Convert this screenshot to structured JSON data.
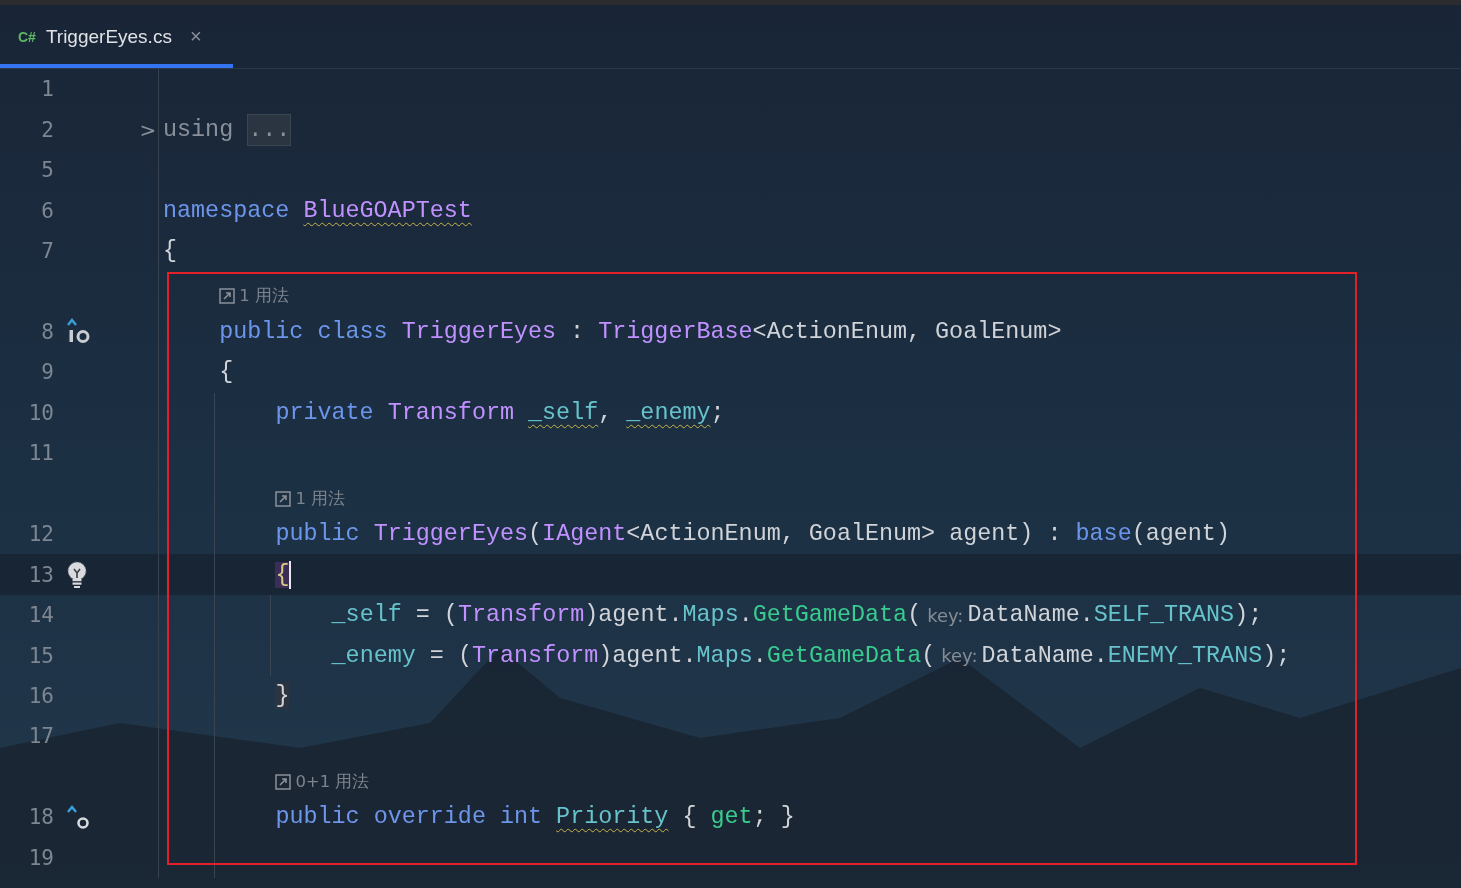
{
  "tab": {
    "lang": "C#",
    "title": "TriggerEyes.cs",
    "close": "×",
    "selected": true
  },
  "rows": [
    {
      "kind": "line",
      "number": "1",
      "current": false,
      "tokens": []
    },
    {
      "kind": "line",
      "number": "2",
      "current": false,
      "gutter": {
        "kind": "fold-collapsed",
        "text": ">"
      },
      "tokens": [
        {
          "text": "using ",
          "kind": "dim",
          "squiggly": false
        },
        {
          "text": "...",
          "kind": "folded",
          "squiggly": false
        }
      ]
    },
    {
      "kind": "line",
      "number": "5",
      "current": false,
      "tokens": []
    },
    {
      "kind": "line",
      "number": "6",
      "current": false,
      "tokens": [
        {
          "text": "namespace ",
          "kind": "keyword",
          "squiggly": false
        },
        {
          "text": "BlueGOAPTest",
          "kind": "type",
          "squiggly": true
        }
      ]
    },
    {
      "kind": "line",
      "number": "7",
      "current": false,
      "tokens": [
        {
          "text": "{",
          "kind": "text",
          "squiggly": false
        }
      ]
    },
    {
      "kind": "hint",
      "indent": "    ",
      "text": "1 用法"
    },
    {
      "kind": "line",
      "number": "8",
      "current": false,
      "gutter": {
        "kind": "class-marker"
      },
      "indent": "    ",
      "tokens": [
        {
          "text": "public class ",
          "kind": "keyword",
          "squiggly": false
        },
        {
          "text": "TriggerEyes",
          "kind": "type",
          "squiggly": false
        },
        {
          "text": " : ",
          "kind": "text",
          "squiggly": false
        },
        {
          "text": "TriggerBase",
          "kind": "type",
          "squiggly": false
        },
        {
          "text": "<ActionEnum, GoalEnum>",
          "kind": "text",
          "squiggly": false
        }
      ]
    },
    {
      "kind": "line",
      "number": "9",
      "current": false,
      "indent": "    ",
      "tokens": [
        {
          "text": "{",
          "kind": "text",
          "squiggly": false
        }
      ]
    },
    {
      "kind": "line",
      "number": "10",
      "current": false,
      "indent": "        ",
      "tokens": [
        {
          "text": "private ",
          "kind": "keyword",
          "squiggly": false
        },
        {
          "text": "Transform ",
          "kind": "type",
          "squiggly": false
        },
        {
          "text": "_self",
          "kind": "field",
          "squiggly": true
        },
        {
          "text": ", ",
          "kind": "text",
          "squiggly": false
        },
        {
          "text": "_enemy",
          "kind": "field",
          "squiggly": true
        },
        {
          "text": ";",
          "kind": "text",
          "squiggly": false
        }
      ]
    },
    {
      "kind": "line",
      "number": "11",
      "current": false,
      "indent": "        ",
      "tokens": []
    },
    {
      "kind": "hint",
      "indent": "        ",
      "text": "1 用法"
    },
    {
      "kind": "line",
      "number": "12",
      "current": false,
      "indent": "        ",
      "tokens": [
        {
          "text": "public ",
          "kind": "keyword",
          "squiggly": false
        },
        {
          "text": "TriggerEyes",
          "kind": "type",
          "squiggly": false
        },
        {
          "text": "(",
          "kind": "text",
          "squiggly": false
        },
        {
          "text": "IAgent",
          "kind": "type",
          "squiggly": false
        },
        {
          "text": "<ActionEnum, GoalEnum> agent) : ",
          "kind": "text",
          "squiggly": false
        },
        {
          "text": "base",
          "kind": "keyword",
          "squiggly": false
        },
        {
          "text": "(agent)",
          "kind": "text",
          "squiggly": false
        }
      ]
    },
    {
      "kind": "line",
      "number": "13",
      "current": true,
      "gutter": {
        "kind": "bulb"
      },
      "indent": "        ",
      "tokens": [
        {
          "text": "{",
          "kind": "brace-match",
          "squiggly": false
        }
      ]
    },
    {
      "kind": "line",
      "number": "14",
      "current": false,
      "indent": "            ",
      "tokens": [
        {
          "text": "_self",
          "kind": "field",
          "squiggly": false
        },
        {
          "text": " = (",
          "kind": "text",
          "squiggly": false
        },
        {
          "text": "Transform",
          "kind": "type",
          "squiggly": false
        },
        {
          "text": ")agent.",
          "kind": "text",
          "squiggly": false
        },
        {
          "text": "Maps",
          "kind": "field",
          "squiggly": false
        },
        {
          "text": ".",
          "kind": "text",
          "squiggly": false
        },
        {
          "text": "GetGameData",
          "kind": "method",
          "squiggly": false
        },
        {
          "text": "(",
          "kind": "text",
          "squiggly": false
        },
        {
          "text": "key:",
          "kind": "param-hint",
          "squiggly": false
        },
        {
          "text": "DataName.",
          "kind": "text",
          "squiggly": false
        },
        {
          "text": "SELF_TRANS",
          "kind": "field",
          "squiggly": false
        },
        {
          "text": ");",
          "kind": "text",
          "squiggly": false
        }
      ]
    },
    {
      "kind": "line",
      "number": "15",
      "current": false,
      "indent": "            ",
      "tokens": [
        {
          "text": "_enemy",
          "kind": "field",
          "squiggly": false
        },
        {
          "text": " = (",
          "kind": "text",
          "squiggly": false
        },
        {
          "text": "Transform",
          "kind": "type",
          "squiggly": false
        },
        {
          "text": ")agent.",
          "kind": "text",
          "squiggly": false
        },
        {
          "text": "Maps",
          "kind": "field",
          "squiggly": false
        },
        {
          "text": ".",
          "kind": "text",
          "squiggly": false
        },
        {
          "text": "GetGameData",
          "kind": "method",
          "squiggly": false
        },
        {
          "text": "(",
          "kind": "text",
          "squiggly": false
        },
        {
          "text": "key:",
          "kind": "param-hint",
          "squiggly": false
        },
        {
          "text": "DataName.",
          "kind": "text",
          "squiggly": false
        },
        {
          "text": "ENEMY_TRANS",
          "kind": "field",
          "squiggly": false
        },
        {
          "text": ");",
          "kind": "text",
          "squiggly": false
        }
      ]
    },
    {
      "kind": "line",
      "number": "16",
      "current": false,
      "indent": "        ",
      "tokens": [
        {
          "text": "}",
          "kind": "brace-pair",
          "squiggly": false
        }
      ]
    },
    {
      "kind": "line",
      "number": "17",
      "current": false,
      "indent": "        ",
      "tokens": []
    },
    {
      "kind": "hint",
      "indent": "        ",
      "text": "0+1 用法"
    },
    {
      "kind": "line",
      "number": "18",
      "current": false,
      "gutter": {
        "kind": "override-marker"
      },
      "indent": "        ",
      "tokens": [
        {
          "text": "public override int ",
          "kind": "keyword",
          "squiggly": false
        },
        {
          "text": "Priority",
          "kind": "field",
          "squiggly": true
        },
        {
          "text": " { ",
          "kind": "text",
          "squiggly": false
        },
        {
          "text": "get",
          "kind": "method",
          "squiggly": false
        },
        {
          "text": "; }",
          "kind": "text",
          "squiggly": false
        }
      ]
    },
    {
      "kind": "line",
      "number": "19",
      "current": false,
      "indent": "        ",
      "tokens": []
    }
  ],
  "annotation": {
    "kind": "frame"
  }
}
